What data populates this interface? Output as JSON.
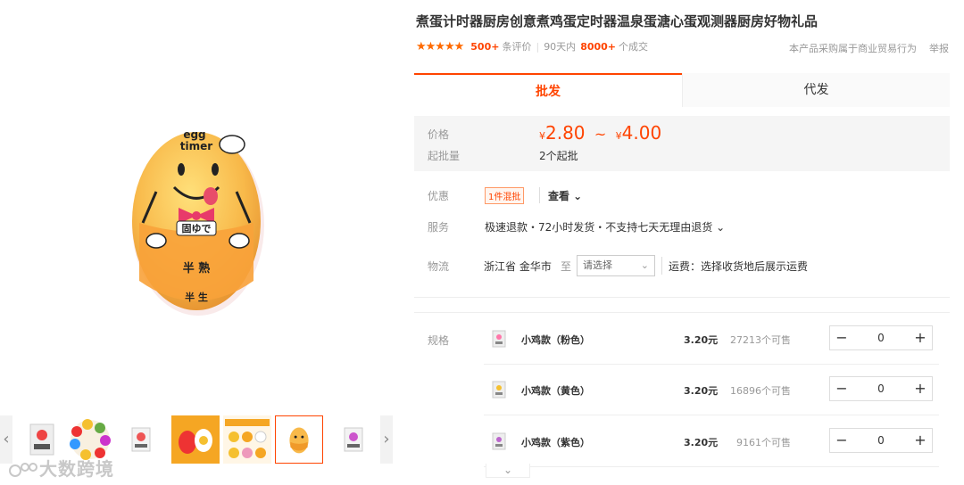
{
  "product": {
    "title": "煮蛋计时器厨房创意煮鸡蛋定时器温泉蛋溏心蛋观测器厨房好物礼品",
    "rating": {
      "stars": "★★★★★",
      "review_count": "500+",
      "review_suffix": "条评价",
      "period": "90天内",
      "deal_count": "8000+",
      "deal_suffix": "个成交"
    },
    "biz_note": "本产品采购属于商业贸易行为",
    "report": "举报"
  },
  "main_image": {
    "egg_text_top": "egg",
    "egg_text_timer": "timer",
    "mouth_text": "固ゆで",
    "apron_text1": "半 熟",
    "apron_text2": "半 生"
  },
  "thumbs": {
    "prev": "‹",
    "next": "›",
    "count": 7,
    "active_index": 6
  },
  "watermark": "大数跨境",
  "tabs": [
    {
      "label": "批发",
      "active": true
    },
    {
      "label": "代发",
      "active": false
    }
  ],
  "price_box": {
    "price_label": "价格",
    "currency": "¥",
    "price_min": "2.80",
    "tilde": "~",
    "price_max": "4.00",
    "moq_label": "起批量",
    "moq_value": "2个起批"
  },
  "discount": {
    "label": "优惠",
    "tag": "1件混批",
    "see": "查看 ⌄"
  },
  "service": {
    "label": "服务",
    "text": "极速退款・72小时发货・不支持七天无理由退货 ⌄"
  },
  "logistics": {
    "label": "物流",
    "origin": "浙江省 金华市",
    "to": "至",
    "region_placeholder": "请选择",
    "freight": "运费：选择收货地后展示运费"
  },
  "spec": {
    "label": "规格",
    "skus": [
      {
        "name": "小鸡款（粉色）",
        "price": "3.20元",
        "stock": "27213个可售",
        "qty": "0"
      },
      {
        "name": "小鸡款（黄色）",
        "price": "3.20元",
        "stock": "16896个可售",
        "qty": "0"
      },
      {
        "name": "小鸡款（紫色）",
        "price": "3.20元",
        "stock": "9161个可售",
        "qty": "0"
      }
    ],
    "minus": "−",
    "plus": "+",
    "expand": "⌄"
  },
  "colors": {
    "accent": "#ff4400",
    "egg_orange": "#f7a53a",
    "egg_yellow": "#ffd45c"
  }
}
